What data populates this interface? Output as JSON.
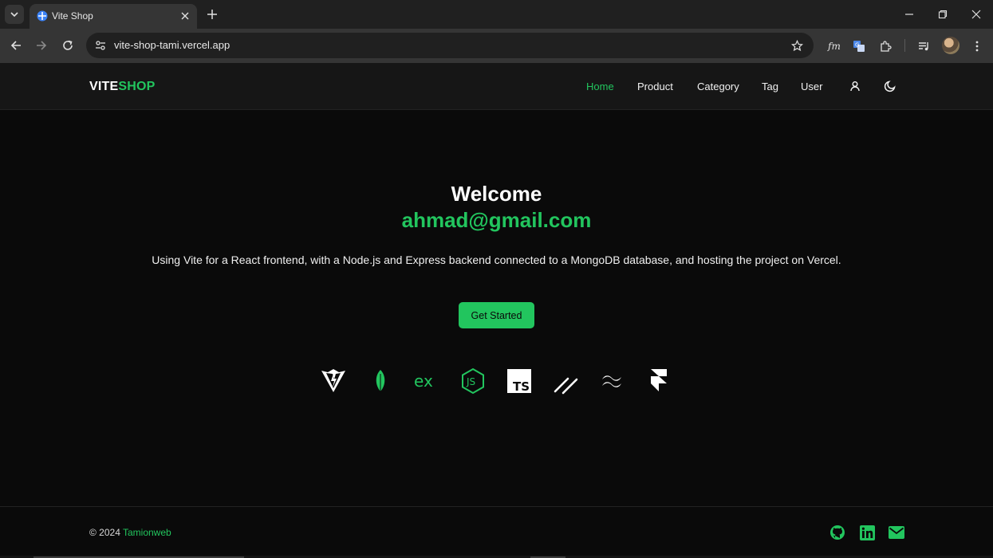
{
  "browser": {
    "tab": {
      "title": "Vite Shop"
    },
    "url": "vite-shop-tami.vercel.app"
  },
  "header": {
    "logo": {
      "part1": "VITE",
      "part2": "SHOP"
    },
    "nav": [
      {
        "label": "Home",
        "active": true
      },
      {
        "label": "Product"
      },
      {
        "label": "Category"
      },
      {
        "label": "Tag"
      },
      {
        "label": "User"
      }
    ],
    "icons": [
      "user-icon",
      "moon-icon"
    ]
  },
  "hero": {
    "welcome": "Welcome",
    "email": "ahmad@gmail.com",
    "description": "Using Vite for a React frontend, with a Node.js and Express backend connected to a MongoDB database, and hosting the project on Vercel.",
    "cta_label": "Get Started"
  },
  "tech_icons": [
    "vite-icon",
    "mongodb-icon",
    "express-icon",
    "nodejs-icon",
    "typescript-icon",
    "shadcn-icon",
    "tailwind-icon",
    "framer-icon"
  ],
  "footer": {
    "copyright_prefix": "© 2024",
    "copyright_brand": "Tamionweb",
    "social": [
      "github-icon",
      "linkedin-icon",
      "mail-icon"
    ]
  },
  "colors": {
    "accent": "#22c55e",
    "background": "#0a0a0a",
    "header_bg": "#161616"
  }
}
